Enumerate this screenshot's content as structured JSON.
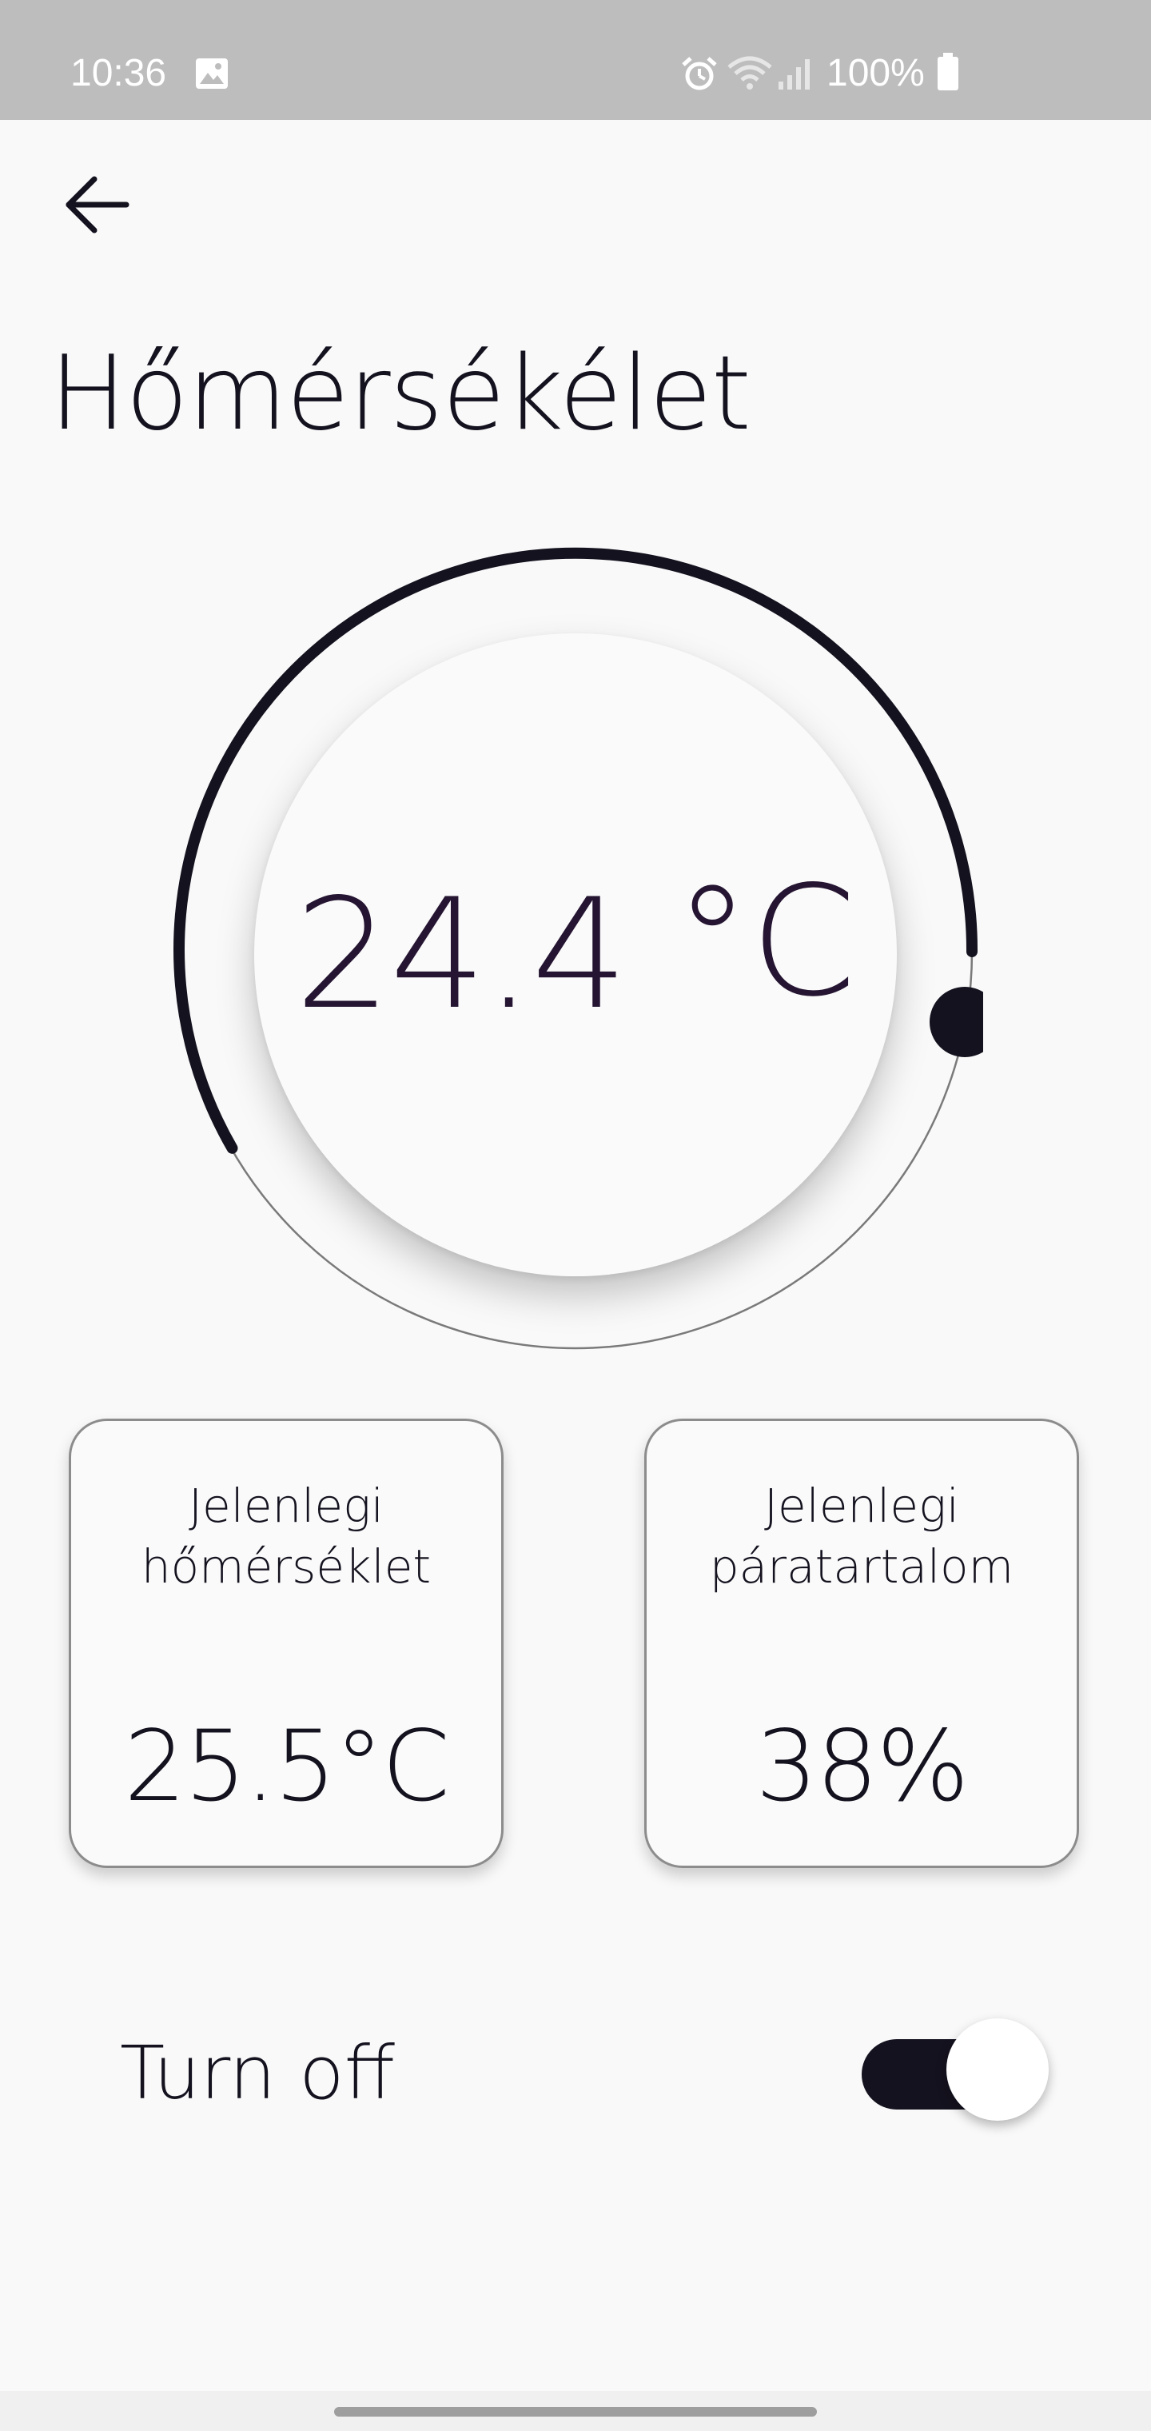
{
  "status_bar": {
    "time": "10:36",
    "battery": "100%",
    "icons": [
      "image-icon",
      "alarm-icon",
      "wifi-icon",
      "signal-icon",
      "battery-icon"
    ]
  },
  "header": {
    "back_icon": "arrow-left-icon",
    "title": "Hőmérsékélet"
  },
  "dial": {
    "target_value": "24.4",
    "unit": "°C",
    "arc_color": "#15121f",
    "value_color": "#251532"
  },
  "cards": [
    {
      "label_line1": "Jelenlegi",
      "label_line2": "hőmérséklet",
      "value": "25.5°C"
    },
    {
      "label_line1": "Jelenlegi",
      "label_line2": "páratartalom",
      "value": "38%"
    }
  ],
  "power": {
    "label": "Turn off",
    "enabled": true
  },
  "colors": {
    "accent": "#15121f",
    "background": "#f9f9f9",
    "status_bar": "#bdbdbd"
  }
}
